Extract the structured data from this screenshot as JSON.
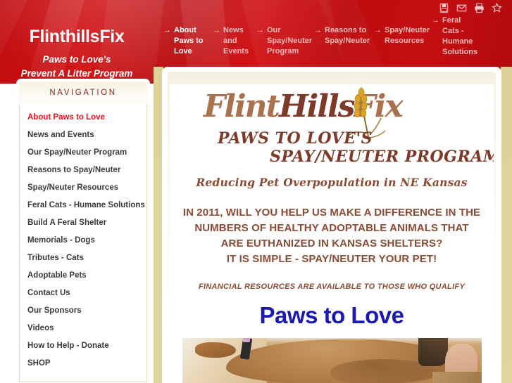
{
  "header": {
    "site_title": "FlinthillsFix",
    "tagline_line1": "Paws to Love's",
    "tagline_line2": "Prevent A Litter Program",
    "util_icons": [
      {
        "name": "save-icon",
        "label": "Save"
      },
      {
        "name": "email-icon",
        "label": "Email"
      },
      {
        "name": "print-icon",
        "label": "Print"
      },
      {
        "name": "favorite-star-icon",
        "label": "Add to favorites"
      }
    ],
    "topnav": [
      {
        "label": "About Paws to Love",
        "active": true
      },
      {
        "label": "News and Events",
        "active": false
      },
      {
        "label": "Our Spay/Neuter Program",
        "active": false
      },
      {
        "label": "Reasons to Spay/Neuter",
        "active": false
      },
      {
        "label": "Spay/Neuter Resources",
        "active": false
      },
      {
        "label": "Feral Cats - Humane Solutions",
        "active": false
      }
    ],
    "nav_arrow": "→"
  },
  "sidebar": {
    "heading": "NAVIGATION",
    "items": [
      {
        "label": "About Paws to Love",
        "active": true
      },
      {
        "label": "News and Events",
        "active": false
      },
      {
        "label": "Our Spay/Neuter Program",
        "active": false
      },
      {
        "label": "Reasons to Spay/Neuter",
        "active": false
      },
      {
        "label": "Spay/Neuter Resources",
        "active": false
      },
      {
        "label": "Feral Cats - Humane Solutions",
        "active": false
      },
      {
        "label": "Build A Feral Shelter",
        "active": false
      },
      {
        "label": "Memorials - Dogs",
        "active": false
      },
      {
        "label": "Tributes - Cats",
        "active": false
      },
      {
        "label": "Adoptable Pets",
        "active": false
      },
      {
        "label": "Contact Us",
        "active": false
      },
      {
        "label": "Our Sponsors",
        "active": false
      },
      {
        "label": "Videos",
        "active": false
      },
      {
        "label": "How to Help - Donate",
        "active": false
      },
      {
        "label": "SHOP",
        "active": false
      }
    ]
  },
  "content": {
    "logo": {
      "part1": "Flint",
      "part2": "Hills",
      "part3": "Fix",
      "sub_line1": "PAWS TO LOVE'S",
      "sub_line2": "SPAY/NEUTER PROGRAM",
      "wheat_icon": "wheat-stalk-icon"
    },
    "tagline": "Reducing Pet Overpopulation in NE Kansas",
    "headline_lines": [
      "IN 2011, WILL YOU HELP US MAKE A DIFFERENCE IN THE",
      "NUMBERS OF HEALTHY ADOPTABLE ANIMALS THAT",
      "ARE EUTHANIZED IN KANSAS SHELTERS?",
      "IT IS SIMPLE - SPAY/NEUTER YOUR PET!"
    ],
    "financial_note": "FINANCIAL RESOURCES ARE AVAILABLE TO THOSE WHO QUALIFY",
    "paws_heading": "Paws to Love",
    "photo_alt": "dog-photo"
  },
  "colors": {
    "banner_red": "#c10d10",
    "accent_red": "#e8121b",
    "khaki": "#dcd29a",
    "brown": "#8a4a33",
    "logo_dark": "#7d3a28",
    "heading_blue": "#1a1ab0",
    "nav_heading": "#8a2b23"
  }
}
